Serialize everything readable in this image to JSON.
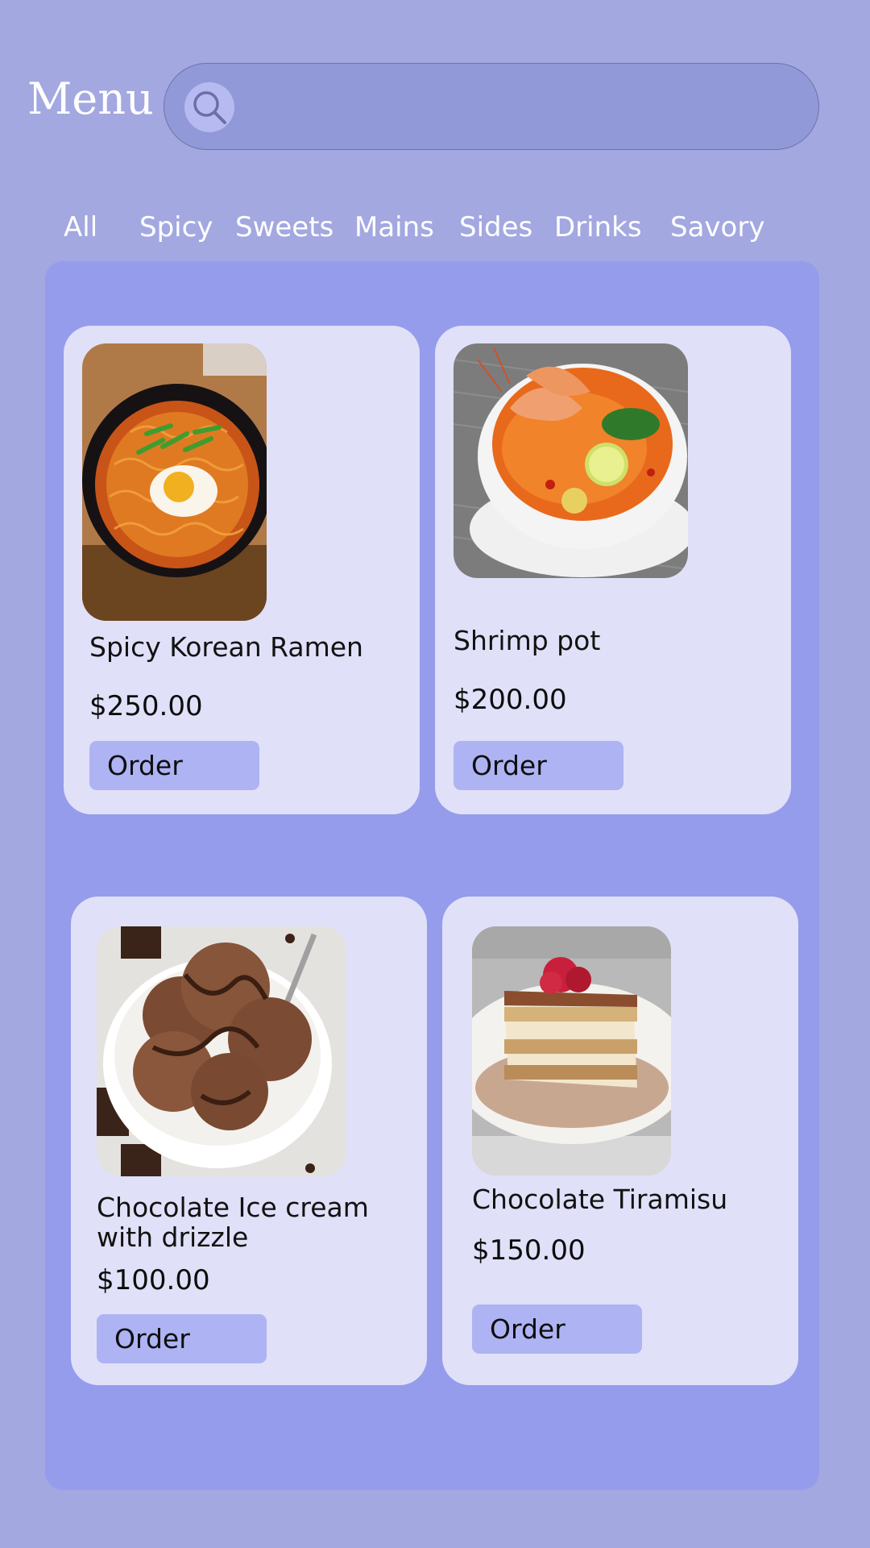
{
  "header": {
    "title": "Menu",
    "search": {
      "value": "",
      "placeholder": ""
    }
  },
  "categories": [
    "All",
    "Spicy",
    "Sweets",
    "Mains",
    "Sides",
    "Drinks",
    "Savory"
  ],
  "dishes": [
    {
      "name": "Spicy Korean Ramen",
      "price": "$250.00",
      "order_label": "Order",
      "image": "ramen-photo"
    },
    {
      "name": "Shrimp pot",
      "price": "$200.00",
      "order_label": "Order",
      "image": "shrimp-soup-photo"
    },
    {
      "name": "Chocolate Ice cream with drizzle",
      "price": "$100.00",
      "order_label": "Order",
      "image": "chocolate-ice-cream-photo"
    },
    {
      "name": "Chocolate Tiramisu",
      "price": "$150.00",
      "order_label": "Order",
      "image": "tiramisu-photo"
    }
  ],
  "colors": {
    "background": "#a3a8e0",
    "panel": "#959ceb",
    "card": "#e0e0f8",
    "search_bar": "#9199d8",
    "order_button": "#aeb3f3",
    "text_light": "#ffffff",
    "text_dark": "#121212"
  }
}
